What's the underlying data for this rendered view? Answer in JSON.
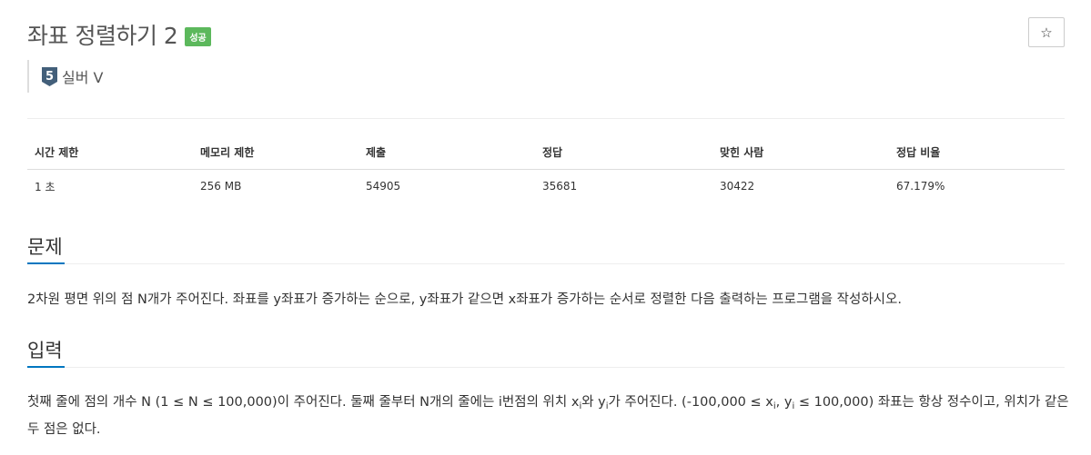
{
  "problem": {
    "title": "좌표 정렬하기 2",
    "status_badge": "성공",
    "tier_number": "5",
    "tier_label": "실버 V",
    "star_icon": "star-icon"
  },
  "info": {
    "headers": [
      "시간 제한",
      "메모리 제한",
      "제출",
      "정답",
      "맞힌 사람",
      "정답 비율"
    ],
    "row": [
      "1 초",
      "256 MB",
      "54905",
      "35681",
      "30422",
      "67.179%"
    ]
  },
  "sections": {
    "problem_title": "문제",
    "problem_text": "2차원 평면 위의 점 N개가 주어진다. 좌표를 y좌표가 증가하는 순으로, y좌표가 같으면 x좌표가 증가하는 순서로 정렬한 다음 출력하는 프로그램을 작성하시오.",
    "input_title": "입력",
    "input_parts": {
      "p1": "첫째 줄에 점의 개수 N (1 ≤ N ≤ 100,000)이 주어진다. 둘째 줄부터 N개의 줄에는 i번점의 위치 x",
      "sub1": "i",
      "p2": "와 y",
      "sub2": "i",
      "p3": "가 주어진다. (-100,000 ≤ x",
      "sub3": "i",
      "p4": ", y",
      "sub4": "i",
      "p5": " ≤ 100,000) 좌표는 항상 정수이고, 위치가 같은 두 점은 없다."
    }
  },
  "colors": {
    "badge_success": "#5cb85c",
    "section_underline": "#0076c0",
    "tier_silver": "#435f7a"
  }
}
